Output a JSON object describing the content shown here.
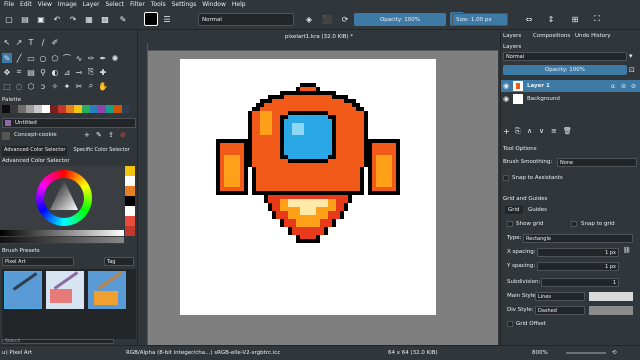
{
  "menu": [
    "File",
    "Edit",
    "View",
    "Image",
    "Layer",
    "Select",
    "Filter",
    "Tools",
    "Settings",
    "Window",
    "Help"
  ],
  "toolbar": {
    "blend_mode": "Normal",
    "opacity": "Opacity: 100%",
    "size": "Size: 1.00 px"
  },
  "palette": {
    "title": "Palette",
    "name": "Untitled",
    "swatches": [
      "#0d0d0d",
      "#3a3a3a",
      "#6d6d6d",
      "#9e9e9e",
      "#c8c8c8",
      "#ffffff",
      "#7a1f1f",
      "#c0392b",
      "#e67e22",
      "#f1c40f",
      "#27ae60",
      "#2980b9",
      "#8e44ad",
      "#16a085",
      "#d35400",
      "#2c3e50"
    ]
  },
  "brush": {
    "preset": "Concept-cookie"
  },
  "color_selector": {
    "tab1": "Advanced Color Selector",
    "tab2": "Specific Color Selector",
    "title": "Advanced Color Selector"
  },
  "brush_presets": {
    "title": "Brush Presets",
    "filter": "Pixel Art",
    "tag": "Tag",
    "search_placeholder": "Search"
  },
  "document": {
    "tab": "pixelart1.kra (32.0 KiB) *"
  },
  "right": {
    "tabs": [
      "Layers",
      "Compositions",
      "Undo History"
    ],
    "layers_title": "Layers",
    "blend": "Normal",
    "opacity": "Opacity: 100%",
    "layers": [
      {
        "name": "Layer 1",
        "selected": true
      },
      {
        "name": "Background",
        "selected": false
      }
    ],
    "tool_options": "Tool Options",
    "brush_smoothing_label": "Brush Smoothing:",
    "brush_smoothing_value": "None",
    "snap_assistants": "Snap to Assistants",
    "grid_guides": "Grid and Guides",
    "grid_tab": "Grid",
    "guides_tab": "Guides",
    "show_grid": "Show grid",
    "snap_grid": "Snap to grid",
    "type_label": "Type:",
    "type_value": "Rectangle",
    "x_spacing_label": "X spacing:",
    "x_spacing": "1 px",
    "y_spacing_label": "Y spacing:",
    "y_spacing": "1 px",
    "subdivision_label": "Subdivision:",
    "subdivision": "1",
    "main_style_label": "Main Style:",
    "main_style": "Lines",
    "div_style_label": "Div Style:",
    "div_style": "Dashed",
    "grid_offset": "Grid Offset"
  },
  "status": {
    "brush": "u) Pixel Art",
    "color": "RGB/Alpha (8-bit integer/cha...)  sRGB-elle-V2-srgbtrc.icc",
    "size": "64 x 64 (32.0 KiB)",
    "zoom": "800%"
  }
}
